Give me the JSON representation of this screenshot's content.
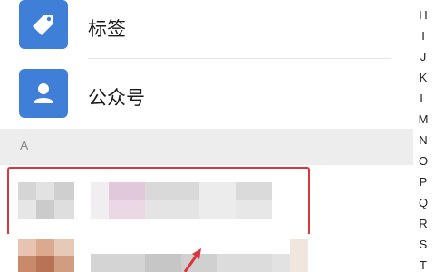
{
  "rows": {
    "tags": {
      "label": "标签",
      "icon": "tag-icon"
    },
    "official_accounts": {
      "label": "公众号",
      "icon": "person-icon"
    }
  },
  "section": {
    "letter": "A"
  },
  "index_bar": {
    "letters": [
      "H",
      "I",
      "J",
      "K",
      "L",
      "M",
      "N",
      "O",
      "P",
      "Q",
      "R",
      "S",
      "T"
    ]
  },
  "colors": {
    "accent": "#3f7fd8",
    "highlight": "#d9363e",
    "section_bg": "#ededed"
  }
}
